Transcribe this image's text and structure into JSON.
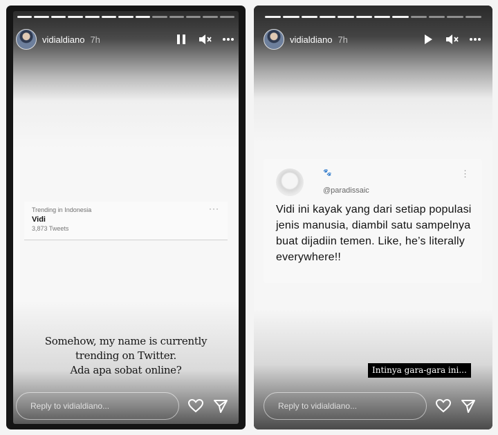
{
  "stories": [
    {
      "progress": [
        1,
        1,
        1,
        1,
        1,
        1,
        1,
        1,
        0,
        0,
        0,
        0,
        0
      ],
      "header": {
        "username": "vidialdiano",
        "time": "7h"
      },
      "trending": {
        "location": "Trending in Indonesia",
        "term": "Vidi",
        "count": "3,873 Tweets"
      },
      "caption": [
        "Somehow, my name is currently",
        "trending on Twitter.",
        "Ada apa sobat online?"
      ],
      "reply_placeholder": "Reply to vidialdiano..."
    },
    {
      "progress": [
        1,
        1,
        1,
        1,
        1,
        1,
        1,
        1,
        0,
        0,
        0,
        0
      ],
      "header": {
        "username": "vidialdiano",
        "time": "7h"
      },
      "tweet": {
        "handle": "@paradissaic",
        "text": "Vidi ini kayak yang dari setiap populasi jenis manusia, diambil satu sampelnya buat dijadiin temen. Like, he’s literally everywhere!!"
      },
      "overlay_label": "Intinya gara-gara ini...",
      "reply_placeholder": "Reply to vidialdiano..."
    }
  ],
  "icons": {
    "pause": "pause-icon",
    "play": "play-icon",
    "mute": "mute-icon",
    "more": "more-icon",
    "heart": "heart-icon",
    "send": "send-icon"
  },
  "colors": {
    "story_bg": "#151515",
    "card_bg": "#f7f7f7",
    "text_dark": "#111111"
  }
}
